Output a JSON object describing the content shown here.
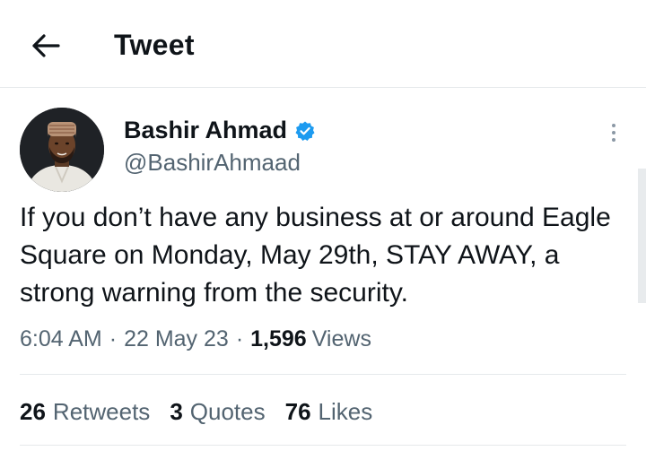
{
  "header": {
    "title": "Tweet",
    "back_icon": "arrow-left-icon"
  },
  "author": {
    "name": "Bashir Ahmad",
    "handle": "@BashirAhmaad",
    "verified_icon": "verified-badge-icon",
    "verified_color": "#1d9bf0"
  },
  "tweet": {
    "text": "If you don’t have any business at or around Eagle Square on Monday, May 29th, STAY AWAY, a strong warning from the security.",
    "time": "6:04 AM",
    "date": "22 May 23",
    "separator": "·",
    "views_count": "1,596",
    "views_label": "Views"
  },
  "stats": {
    "retweets_count": "26",
    "retweets_label": "Retweets",
    "quotes_count": "3",
    "quotes_label": "Quotes",
    "likes_count": "76",
    "likes_label": "Likes"
  },
  "more_icon": "more-vertical-icon"
}
